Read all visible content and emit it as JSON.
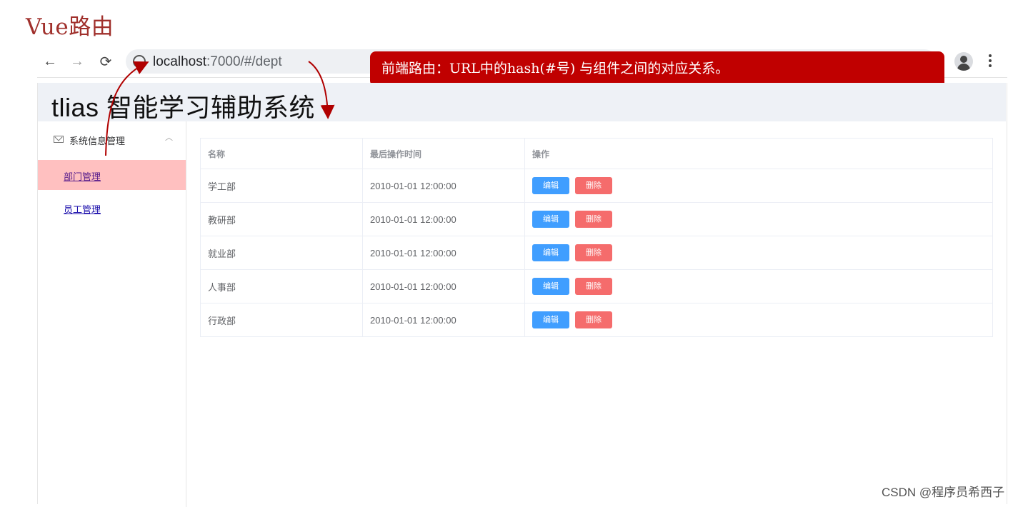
{
  "slide": {
    "title": "Vue路由"
  },
  "browser": {
    "url_host": "localhost",
    "url_rest": ":7000/#/dept"
  },
  "callout": {
    "text": "前端路由：URL中的hash(#号) 与组件之间的对应关系。"
  },
  "app": {
    "title": "tlias 智能学习辅助系统",
    "menu": {
      "group": "系统信息管理",
      "items": [
        {
          "label": "部门管理",
          "active": true
        },
        {
          "label": "员工管理",
          "active": false
        }
      ]
    },
    "table": {
      "headers": [
        "名称",
        "最后操作时间",
        "操作"
      ],
      "rows": [
        {
          "name": "学工部",
          "time": "2010-01-01 12:00:00"
        },
        {
          "name": "教研部",
          "time": "2010-01-01 12:00:00"
        },
        {
          "name": "就业部",
          "time": "2010-01-01 12:00:00"
        },
        {
          "name": "人事部",
          "time": "2010-01-01 12:00:00"
        },
        {
          "name": "行政部",
          "time": "2010-01-01 12:00:00"
        }
      ],
      "edit_label": "编辑",
      "delete_label": "删除"
    }
  },
  "colors": {
    "callout": "#c00000",
    "edit": "#409eff",
    "delete": "#f56c6c",
    "active_menu": "#ffc0c0",
    "title": "#a0302c"
  },
  "watermark": "CSDN @程序员希西子"
}
